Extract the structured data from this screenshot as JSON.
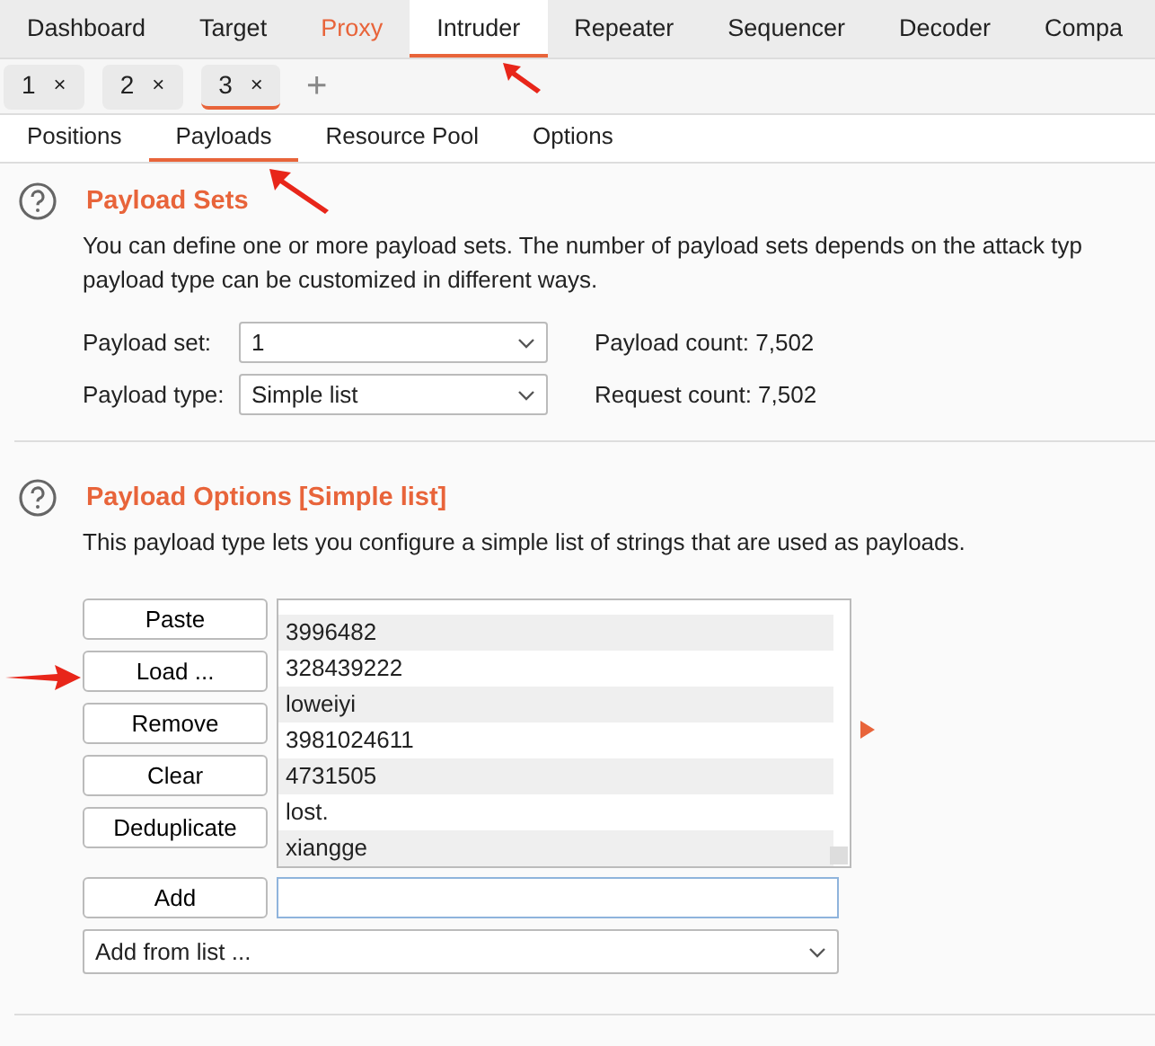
{
  "main_tabs": [
    {
      "label": "Dashboard",
      "selected": false,
      "highlighted": false
    },
    {
      "label": "Target",
      "selected": false,
      "highlighted": false
    },
    {
      "label": "Proxy",
      "selected": false,
      "highlighted": true
    },
    {
      "label": "Intruder",
      "selected": true,
      "highlighted": false
    },
    {
      "label": "Repeater",
      "selected": false,
      "highlighted": false
    },
    {
      "label": "Sequencer",
      "selected": false,
      "highlighted": false
    },
    {
      "label": "Decoder",
      "selected": false,
      "highlighted": false
    },
    {
      "label": "Compa",
      "selected": false,
      "highlighted": false
    }
  ],
  "instance_tabs": [
    {
      "label": "1",
      "close": "×",
      "selected": false
    },
    {
      "label": "2",
      "close": "×",
      "selected": false
    },
    {
      "label": "3",
      "close": "×",
      "selected": true
    }
  ],
  "add_tab": "+",
  "sub_tabs": [
    {
      "label": "Positions",
      "selected": false
    },
    {
      "label": "Payloads",
      "selected": true
    },
    {
      "label": "Resource Pool",
      "selected": false
    },
    {
      "label": "Options",
      "selected": false
    }
  ],
  "payload_sets": {
    "title": "Payload Sets",
    "description": [
      "You can define one or more payload sets. The number of payload sets depends on the attack typ",
      "payload type can be customized in different ways."
    ],
    "fields": [
      {
        "label": "Payload set:",
        "value": "1",
        "info": "Payload count: 7,502"
      },
      {
        "label": "Payload type:",
        "value": "Simple list",
        "info": "Request count: 7,502"
      }
    ]
  },
  "payload_options": {
    "title": "Payload Options [Simple list]",
    "description": "This payload type lets you configure a simple list of strings that are used as payloads.",
    "buttons": [
      "Paste",
      "Load ...",
      "Remove",
      "Clear",
      "Deduplicate"
    ],
    "items": [
      "3996482",
      "328439222",
      "loweiyi",
      "3981024611",
      "4731505",
      "lost.",
      "xiangge"
    ],
    "add_button": "Add",
    "add_from_list": "Add from list ..."
  }
}
